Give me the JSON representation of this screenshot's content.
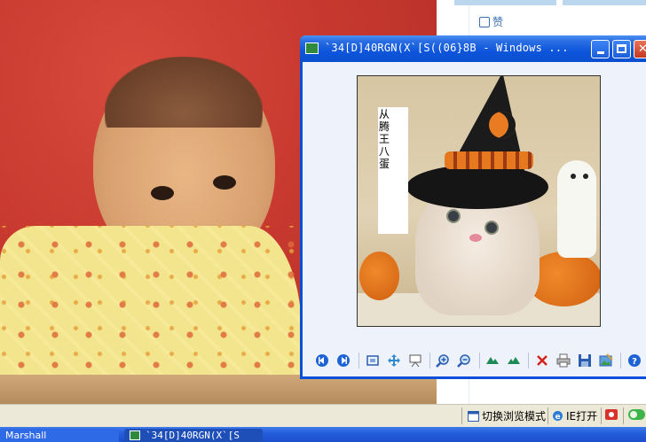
{
  "web": {
    "like_label": "赞"
  },
  "viewer": {
    "title": "`34[D]40RGN(X`[S((06}8B - Windows ...",
    "caption": "从腾王八蛋",
    "toolbar": {
      "previous": "previous-image-icon",
      "next": "next-image-icon",
      "best_fit": "best-fit-icon",
      "actual_size": "actual-size-icon",
      "slideshow": "slideshow-icon",
      "zoom_in": "zoom-in-icon",
      "zoom_out": "zoom-out-icon",
      "rotate_clockwise": "rotate-clockwise-icon",
      "rotate_counterclockwise": "rotate-counterclockwise-icon",
      "delete": "delete-icon",
      "print": "print-icon",
      "save": "save-icon",
      "open_with": "edit-icon",
      "help": "help-icon"
    }
  },
  "statusbar": {
    "switch_mode": "切换浏览模式",
    "ie_open": "IE打开"
  },
  "taskbar": {
    "tasks": [
      {
        "label": "Marshall"
      },
      {
        "label": "`34[D]40RGN(X`[S"
      }
    ]
  },
  "colors": {
    "titlebar": "#0d55db",
    "window_bg": "#eef2fb",
    "statusbar_bg": "#ece9d8",
    "taskbar": "#245edb"
  }
}
